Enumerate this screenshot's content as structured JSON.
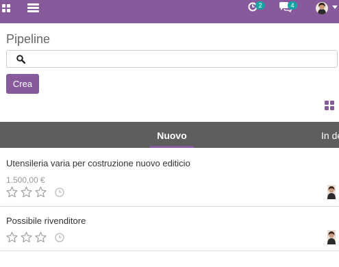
{
  "navbar": {
    "apps_icon": "apps-grid-icon",
    "menu_icon": "hamburger-menu-icon",
    "activity_icon": "clock-activity-icon",
    "activity_count": "2",
    "chat_icon": "chat-bubbles-icon",
    "chat_count": "4",
    "avatar_icon": "user-avatar",
    "caret_icon": "caret-down-icon",
    "colors": {
      "background": "#875a9c",
      "badge": "#16a3a3"
    }
  },
  "page": {
    "title": "Pipeline",
    "search_placeholder": "",
    "search_icon": "search-icon",
    "create_label": "Crea",
    "view_switch_icon": "kanban-view-icon"
  },
  "stages": {
    "active": "Nuovo",
    "next": "In de"
  },
  "cards": [
    {
      "title": "Utensileria varia per costruzione nuovo editicio",
      "amount": "1.500,00 €",
      "priority_stars": 0,
      "max_stars": 3
    },
    {
      "title": "Possibile rivenditore",
      "amount": "",
      "priority_stars": 0,
      "max_stars": 3
    }
  ],
  "colors": {
    "accent": "#875a9c",
    "stage_bar": "#5f5e5e"
  }
}
